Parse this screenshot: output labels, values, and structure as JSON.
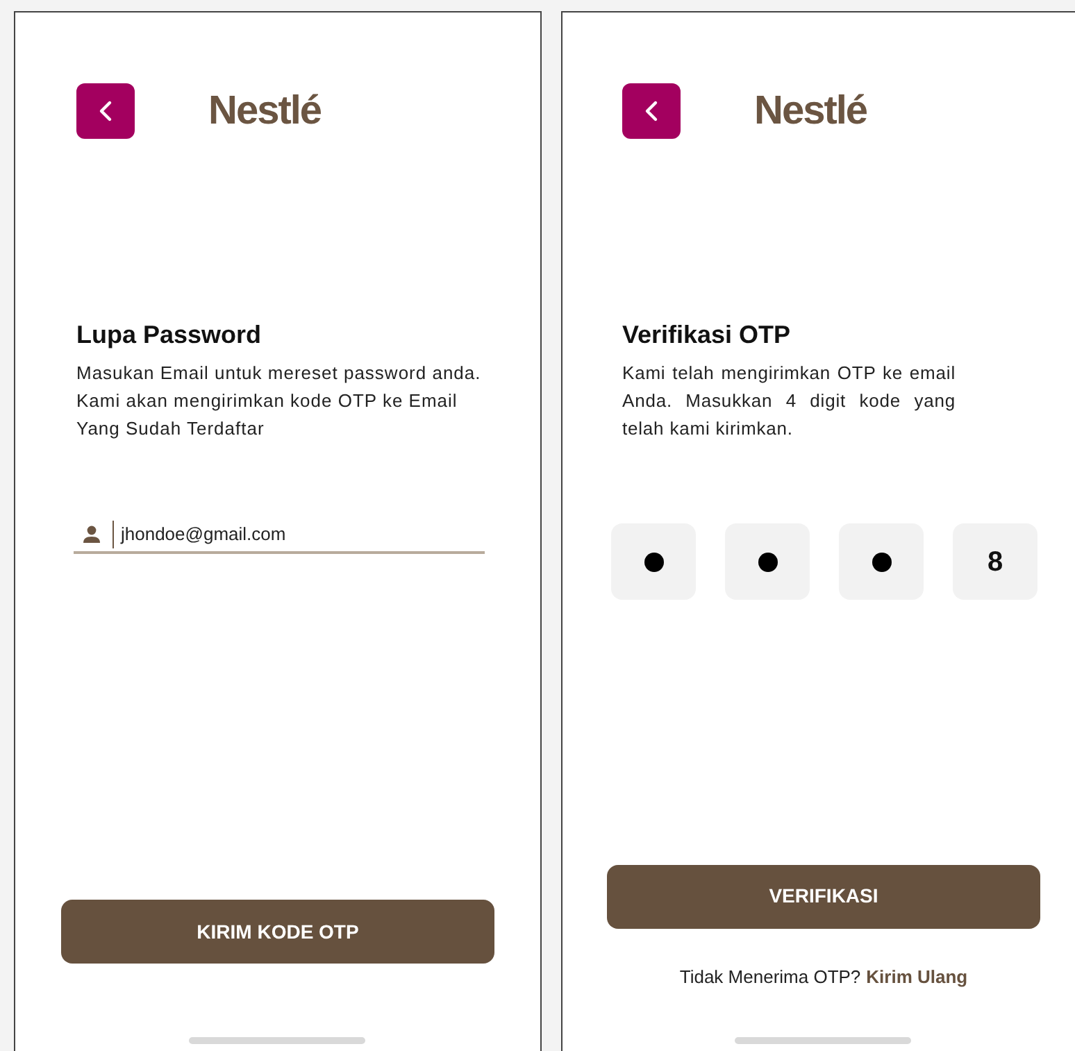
{
  "screens": [
    {
      "kind": "forgot",
      "logo": "Nestlé",
      "title": "Lupa Password",
      "description": "Masukan Email untuk mereset password anda. Kami akan mengirimkan kode OTP ke Email Yang Sudah Terdaftar",
      "email_field": {
        "value": "jhondoe@gmail.com"
      },
      "button": "KIRIM KODE OTP"
    },
    {
      "kind": "otp",
      "logo": "Nestlé",
      "title": "Verifikasi OTP",
      "description": "Kami telah mengirimkan OTP ke email Anda. Masukkan 4 digit kode yang telah kami kirimkan.",
      "otp_digits": [
        {
          "masked": true
        },
        {
          "masked": true
        },
        {
          "masked": true
        },
        {
          "masked": false,
          "value": "8"
        }
      ],
      "button": "VERIFIKASI",
      "resend": {
        "prompt": "Tidak Menerima OTP?",
        "link": "Kirim Ulang"
      }
    }
  ]
}
